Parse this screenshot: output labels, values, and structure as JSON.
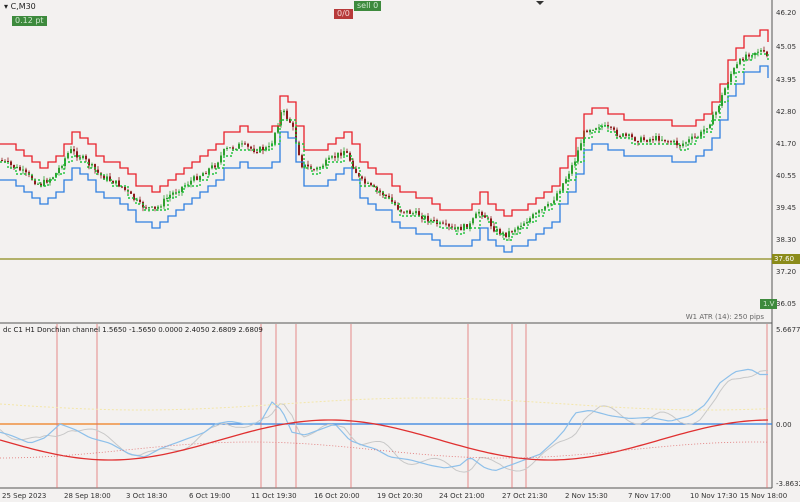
{
  "symbol": "C,M30",
  "badges": {
    "price": "0.12 pt",
    "sell": "sell 0",
    "sell_box": "0/0"
  },
  "main_axis": [
    "46.20",
    "45.05",
    "43.95",
    "42.80",
    "41.70",
    "40.55",
    "39.45",
    "38.30",
    "37.20",
    "36.05"
  ],
  "level_line": {
    "price": "37.60",
    "color": "#8b8b1a"
  },
  "atr_label": "W1 ATR (14): 250 pips",
  "small_box": "1.V",
  "indicator": {
    "title": "dc C1 H1 Donchian channel 1.5650 -1.5650 0.0000 2.4050 2.6809 2.6809",
    "axis": [
      "5.6677",
      "0.00",
      "-3.8632"
    ]
  },
  "time_axis": [
    "25 Sep 2023",
    "28 Sep 18:00",
    "3 Oct 18:30",
    "6 Oct 19:00",
    "11 Oct 19:30",
    "16 Oct 20:00",
    "19 Oct 20:30",
    "24 Oct 21:00",
    "27 Oct 21:30",
    "2 Nov 15:30",
    "7 Nov 17:00",
    "10 Nov 17:30",
    "15 Nov 18:00"
  ],
  "colors": {
    "bull": "#2e9e2e",
    "bear": "#8b1a1a",
    "upper": "#e8202a",
    "lower": "#2f7fe0",
    "mid": "#1ec23b",
    "zero": "#2f7fe0",
    "orange": "#ff9a40"
  }
}
